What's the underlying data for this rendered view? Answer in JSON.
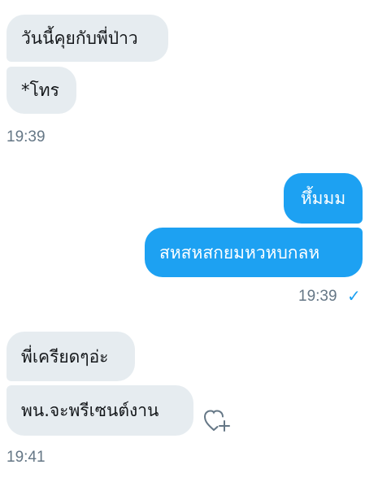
{
  "thread": {
    "group1": {
      "messages": [
        {
          "text": "วันนี้คุยกับพี่ป่าว"
        },
        {
          "text": "*โทร"
        }
      ],
      "time": "19:39"
    },
    "group2": {
      "messages": [
        {
          "text": "หึ้มมม"
        },
        {
          "text": "สหสหสกยมหวหบกลห"
        }
      ],
      "time": "19:39",
      "status_icon": "check-icon"
    },
    "group3": {
      "messages": [
        {
          "text": "พี่เครียดๆอ่ะ"
        },
        {
          "text": "พน.จะพรีเซนต์งาน"
        }
      ],
      "time": "19:41",
      "reaction_icon": "heart-add-icon"
    }
  },
  "colors": {
    "incoming_bubble": "#e6ecf0",
    "outgoing_bubble": "#1da1f2",
    "timestamp": "#657786"
  }
}
